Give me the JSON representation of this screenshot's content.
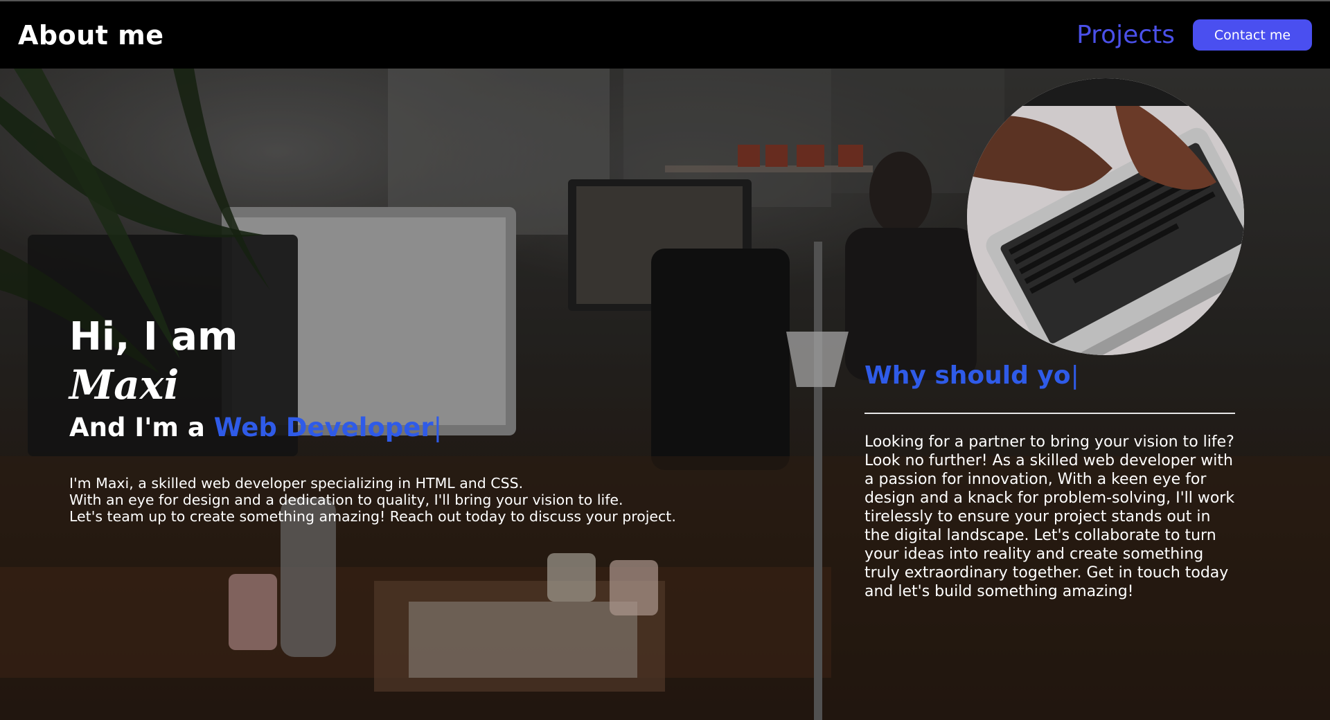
{
  "header": {
    "brand": "About me",
    "projects_label": "Projects",
    "contact_label": "Contact me"
  },
  "intro": {
    "greeting": "Hi, I am",
    "name": "Maxi",
    "role_prefix": "And I'm a ",
    "role_highlight": "Web Developer",
    "cursor": "|",
    "bio_lines": [
      "I'm Maxi, a skilled web developer specializing in HTML and CSS.",
      "With an eye for design and a dedication to quality, I'll bring your vision to life.",
      "Let's team up to create something amazing! Reach out today to discuss your project."
    ]
  },
  "why": {
    "heading": "Why should yo",
    "cursor": "|",
    "body": "Looking for a partner to bring your vision to life? Look no further! As a skilled web developer with a passion for innovation, With a keen eye for design and a knack for problem-solving, I'll work tirelessly to ensure your project stands out in the digital landscape. Let's collaborate to turn your ideas into reality and create something truly extraordinary together. Get in touch today and let's build something amazing!"
  },
  "colors": {
    "accent": "#4a4ff0",
    "highlight": "#2f5be8",
    "navbar_bg": "#000000",
    "text": "#ffffff"
  }
}
